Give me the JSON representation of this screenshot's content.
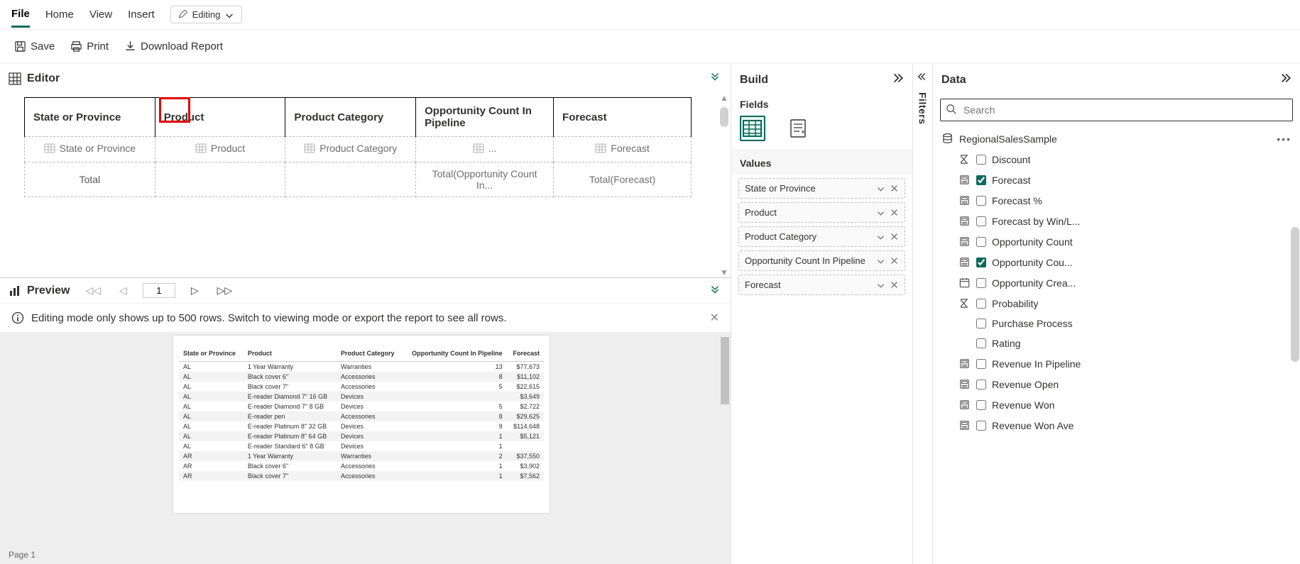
{
  "tabs": {
    "file": "File",
    "home": "Home",
    "view": "View",
    "insert": "Insert"
  },
  "editing": {
    "label": "Editing"
  },
  "toolbar": {
    "save": "Save",
    "print": "Print",
    "download": "Download Report"
  },
  "editor": {
    "title": "Editor",
    "headers": [
      "State or Province",
      "Product",
      "Product Category",
      "Opportunity Count In Pipeline",
      "Forecast"
    ],
    "placeholders": [
      "State or Province",
      "Product",
      "Product Category",
      "...",
      "Forecast"
    ],
    "totals": [
      "Total",
      "",
      "",
      "Total(Opportunity Count In...",
      "Total(Forecast)"
    ]
  },
  "preview": {
    "title": "Preview",
    "page": "1",
    "notice": "Editing mode only shows up to 500 rows. Switch to viewing mode or export the report to see all rows.",
    "headers": [
      "State or Province",
      "Product",
      "Product Category",
      "Opportunity Count In Pipeline",
      "Forecast"
    ],
    "rows": [
      [
        "AL",
        "1 Year Warranty",
        "Warranties",
        "13",
        "$77,673"
      ],
      [
        "AL",
        "Black cover 6\"",
        "Accessories",
        "8",
        "$11,102"
      ],
      [
        "AL",
        "Black cover 7\"",
        "Accessories",
        "5",
        "$22,615"
      ],
      [
        "AL",
        "E-reader Diamond 7\" 16 GB",
        "Devices",
        "",
        "$3,649"
      ],
      [
        "AL",
        "E-reader Diamond 7\" 8 GB",
        "Devices",
        "5",
        "$2,722"
      ],
      [
        "AL",
        "E-reader pen",
        "Accessories",
        "8",
        "$29,625"
      ],
      [
        "AL",
        "E-reader Platinum 8\" 32 GB",
        "Devices",
        "9",
        "$114,648"
      ],
      [
        "AL",
        "E-reader Platinum 8\" 64 GB",
        "Devices",
        "1",
        "$5,121"
      ],
      [
        "AL",
        "E-reader Standard 6\" 8 GB",
        "Devices",
        "1",
        ""
      ],
      [
        "AR",
        "1 Year Warranty",
        "Warranties",
        "2",
        "$37,550"
      ],
      [
        "AR",
        "Black cover 6\"",
        "Accessories",
        "1",
        "$3,902"
      ],
      [
        "AR",
        "Black cover 7\"",
        "Accessories",
        "1",
        "$7,562"
      ]
    ]
  },
  "build": {
    "title": "Build",
    "fields": "Fields",
    "values": "Values",
    "items": [
      "State or Province",
      "Product",
      "Product Category",
      "Opportunity Count In Pipeline",
      "Forecast"
    ]
  },
  "filters": {
    "label": "Filters"
  },
  "data": {
    "title": "Data",
    "search_ph": "Search",
    "dataset": "RegionalSalesSample",
    "fields": [
      {
        "label": "Discount",
        "icon": "sigma",
        "checked": false
      },
      {
        "label": "Forecast",
        "icon": "measure",
        "checked": true
      },
      {
        "label": "Forecast %",
        "icon": "measure",
        "checked": false
      },
      {
        "label": "Forecast by Win/L...",
        "icon": "measure",
        "checked": false
      },
      {
        "label": "Opportunity Count",
        "icon": "measure",
        "checked": false
      },
      {
        "label": "Opportunity Cou...",
        "icon": "measure",
        "checked": true
      },
      {
        "label": "Opportunity Crea...",
        "icon": "calendar",
        "checked": false
      },
      {
        "label": "Probability",
        "icon": "sigma",
        "checked": false
      },
      {
        "label": "Purchase Process",
        "icon": "none",
        "checked": false
      },
      {
        "label": "Rating",
        "icon": "none",
        "checked": false
      },
      {
        "label": "Revenue In Pipeline",
        "icon": "measure",
        "checked": false
      },
      {
        "label": "Revenue Open",
        "icon": "measure",
        "checked": false
      },
      {
        "label": "Revenue Won",
        "icon": "measure",
        "checked": false
      },
      {
        "label": "Revenue Won Ave",
        "icon": "measure",
        "checked": false
      }
    ]
  },
  "footer": {
    "page": "Page 1"
  }
}
